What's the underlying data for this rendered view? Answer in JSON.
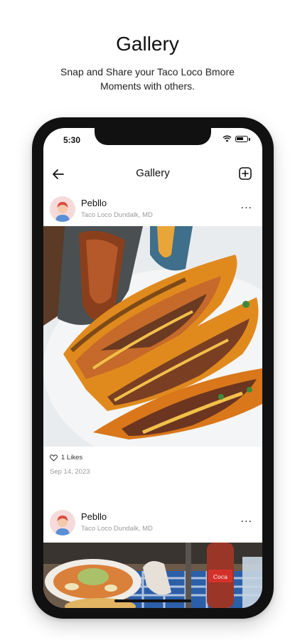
{
  "promo": {
    "title": "Gallery",
    "subtitle": "Snap and Share your Taco Loco Bmore Moments with others."
  },
  "status_bar": {
    "time": "5:30",
    "icons": [
      "wifi-icon",
      "battery-icon"
    ]
  },
  "app_bar": {
    "title": "Gallery",
    "back_icon": "arrow-left-icon",
    "add_icon": "add-square-icon"
  },
  "posts": [
    {
      "user_name": "Pebllo",
      "location": "Taco Loco Dundalk, MD",
      "photo": "birria tacos",
      "likes": "1 Likes",
      "date": "Sep 14, 2023",
      "more_label": "..."
    },
    {
      "user_name": "Pebllo",
      "location": "Taco Loco Dundalk, MD",
      "photo": "soup and drinks on table",
      "more_label": "..."
    }
  ],
  "colors": {
    "background": "#ffffff",
    "phone_frame": "#111111",
    "avatar_bg": "#f3d6d6",
    "taco_orange": "#e08a1e"
  }
}
